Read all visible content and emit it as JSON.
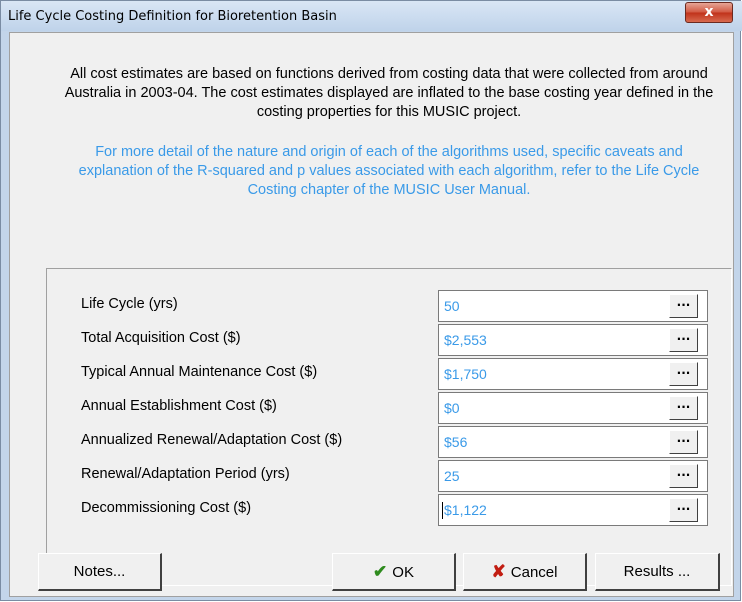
{
  "window": {
    "title": "Life Cycle Costing Definition for Bioretention Basin",
    "close_label": "x"
  },
  "info": {
    "main_text": "All cost estimates are based on functions derived from costing data that were collected from around Australia in 2003-04.  The cost estimates displayed are inflated to the base costing year defined in the costing properties for this MUSIC project.",
    "detail_text": "For more detail of the nature and origin of each of the algorithms used, specific caveats and explanation of the R-squared and p values associated with each algorithm, refer to the Life Cycle Costing chapter of the MUSIC User Manual."
  },
  "fields": [
    {
      "label": "Life Cycle (yrs)",
      "value": "50",
      "button": "..."
    },
    {
      "label": "Total Acquisition Cost ($)",
      "value": "$2,553",
      "button": "..."
    },
    {
      "label": "Typical Annual Maintenance Cost ($)",
      "value": "$1,750",
      "button": "..."
    },
    {
      "label": "Annual Establishment Cost ($)",
      "value": "$0",
      "button": "..."
    },
    {
      "label": "Annualized Renewal/Adaptation Cost ($)",
      "value": "$56",
      "button": "..."
    },
    {
      "label": "Renewal/Adaptation Period (yrs)",
      "value": "25",
      "button": "..."
    },
    {
      "label": "Decommissioning Cost ($)",
      "value": "$1,122",
      "button": "..."
    }
  ],
  "buttons": {
    "notes": "Notes...",
    "ok": "OK",
    "cancel": "Cancel",
    "results": "Results ..."
  },
  "icons": {
    "close": "close-icon",
    "ok": "checkmark-icon",
    "cancel": "x-icon"
  },
  "colors": {
    "info_text": "#000000",
    "detail_text": "#3a9ae8",
    "field_value": "#3a9ae8",
    "ok_check": "#2e8b1e",
    "cancel_x": "#c21d12",
    "close_button": "#c0321a"
  }
}
